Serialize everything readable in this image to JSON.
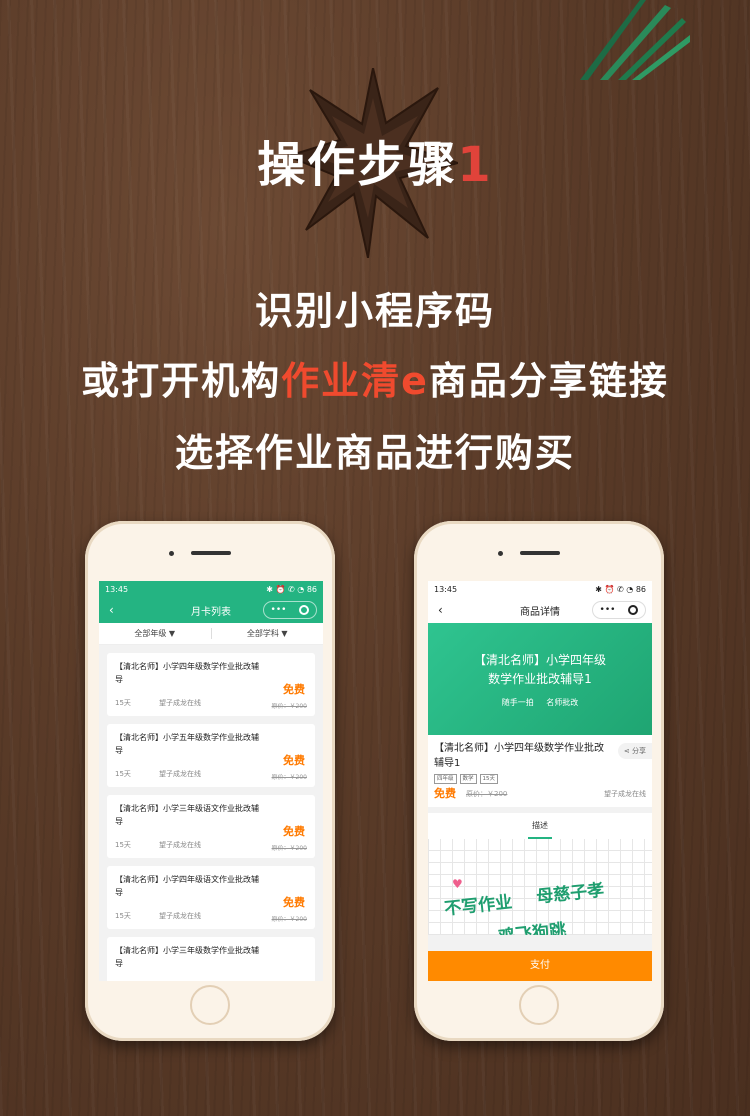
{
  "header": {
    "title_text": "操作步骤",
    "title_num": "1",
    "line1": "识别小程序码",
    "line2_pre": "或打开机构",
    "line2_highlight": "作业清e",
    "line2_post": "商品分享链接",
    "line3": "选择作业商品进行购买"
  },
  "left_phone": {
    "status_time": "13:45",
    "status_icons": "✱ ⏰ ✆ ◔ 86",
    "nav_title": "月卡列表",
    "back": "‹",
    "capsule_dots": "•••",
    "filters": [
      "全部年级 ▼",
      "全部学科 ▼"
    ],
    "cards": [
      {
        "title": "【清北名师】小学四年级数学作业批改辅导",
        "days": "15天",
        "org": "望子成龙在线",
        "price": "免费",
        "original": "原价：￥200"
      },
      {
        "title": "【清北名师】小学五年级数学作业批改辅导",
        "days": "15天",
        "org": "望子成龙在线",
        "price": "免费",
        "original": "原价：￥200"
      },
      {
        "title": "【清北名师】小学三年级语文作业批改辅导",
        "days": "15天",
        "org": "望子成龙在线",
        "price": "免费",
        "original": "原价：￥200"
      },
      {
        "title": "【清北名师】小学四年级语文作业批改辅导",
        "days": "15天",
        "org": "望子成龙在线",
        "price": "免费",
        "original": "原价：￥200"
      },
      {
        "title": "【清北名师】小学三年级数学作业批改辅导",
        "days": "",
        "org": "",
        "price": "",
        "original": ""
      }
    ]
  },
  "right_phone": {
    "status_time": "13:45",
    "status_icons": "✱ ⏰ ✆ ◔ 86",
    "nav_title": "商品详情",
    "back": "‹",
    "capsule_dots": "•••",
    "banner_title_1": "【清北名师】小学四年级",
    "banner_title_2": "数学作业批改辅导1",
    "banner_sub": "随手一拍 名师批改",
    "product_title": "【清北名师】小学四年级数学作业批改辅导1",
    "share": "分享",
    "tags": [
      "四年级",
      "数学",
      "15天"
    ],
    "price": "免费",
    "original": "原价：￥200",
    "org": "望子成龙在线",
    "tab": "描述",
    "ad_1": "不写作业",
    "ad_2": "母慈子孝",
    "ad_3": "鸡飞狗跳",
    "pay": "支付"
  }
}
